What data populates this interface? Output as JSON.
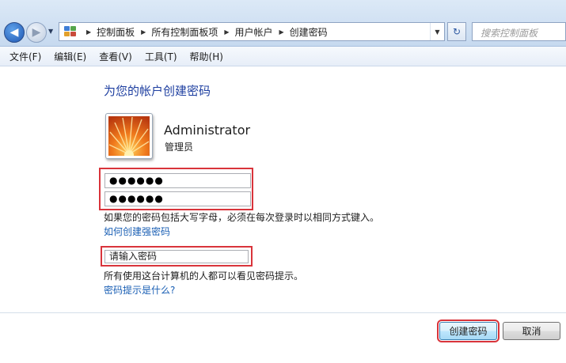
{
  "address": {
    "breadcrumbs": [
      "控制面板",
      "所有控制面板项",
      "用户帐户",
      "创建密码"
    ],
    "search_placeholder": "搜索控制面板"
  },
  "menu": [
    "文件(F)",
    "编辑(E)",
    "查看(V)",
    "工具(T)",
    "帮助(H)"
  ],
  "page": {
    "heading": "为您的帐户创建密码",
    "user": {
      "name": "Administrator",
      "role": "管理员"
    },
    "new_password_mask": "●●●●●●",
    "confirm_password_mask": "●●●●●●",
    "caps_note": "如果您的密码包括大写字母，必须在每次登录时以相同方式键入。",
    "strong_password_link": "如何创建强密码",
    "hint_value": "请输入密码",
    "hint_note": "所有使用这台计算机的人都可以看见密码提示。",
    "hint_help_link": "密码提示是什么?"
  },
  "buttons": {
    "create": "创建密码",
    "cancel": "取消"
  },
  "icons": {
    "back": "back-arrow-icon",
    "forward": "forward-arrow-icon",
    "control_panel": "control-panel-icon",
    "refresh": "refresh-icon",
    "user_picture": "flower-icon"
  },
  "colors": {
    "heading": "#1e3fa0",
    "link": "#1a5fb4",
    "highlight_box": "#d9343b"
  }
}
